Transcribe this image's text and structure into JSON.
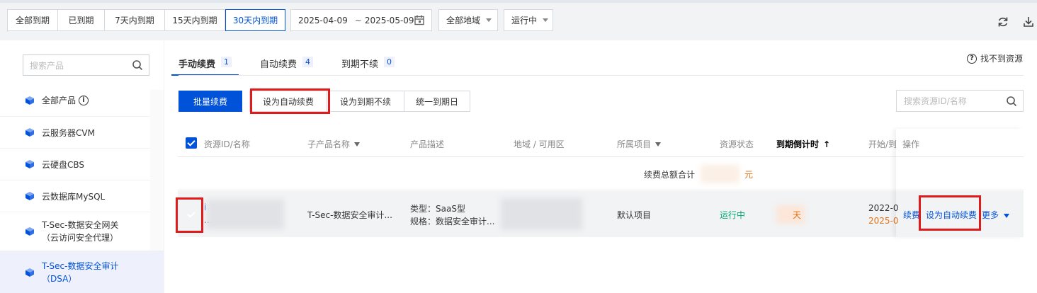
{
  "filter": {
    "expiry_options": [
      {
        "label": "全部到期",
        "active": false
      },
      {
        "label": "已到期",
        "active": false
      },
      {
        "label": "7天内到期",
        "active": false
      },
      {
        "label": "15天内到期",
        "active": false
      },
      {
        "label": "30天内到期",
        "active": true
      }
    ],
    "date_start": "2025-04-09",
    "date_sep": "~",
    "date_end": "2025-05-09",
    "region": "全部地域",
    "status": "运行中",
    "icons": [
      "refresh-icon",
      "download-icon"
    ]
  },
  "sidebar": {
    "search_placeholder": "搜索产品",
    "items": [
      {
        "label": "全部产品",
        "has_info": true,
        "active": false
      },
      {
        "label": "云服务器CVM",
        "active": false
      },
      {
        "label": "云硬盘CBS",
        "active": false
      },
      {
        "label": "云数据库MySQL",
        "active": false
      },
      {
        "label_line1": "T-Sec-数据安全网关",
        "label_line2": "（云访问安全代理）",
        "active": false
      },
      {
        "label_line1": "T-Sec-数据安全审计",
        "label_line2": "（DSA）",
        "active": true
      }
    ]
  },
  "tabs": [
    {
      "label": "手动续费",
      "count": "1",
      "active": true
    },
    {
      "label": "自动续费",
      "count": "4",
      "active": false
    },
    {
      "label": "到期不续",
      "count": "0",
      "active": false
    }
  ],
  "cant_find": "找不到资源",
  "actions": {
    "batch_renew": "批量续费",
    "set_auto_renew": "设为自动续费",
    "set_no_renew": "设为到期不续",
    "unify_expiry": "统一到期日"
  },
  "table_search_placeholder": "搜索资源ID/名称",
  "columns": {
    "resource": "资源ID/名称",
    "sub_product": "子产品名称",
    "description": "产品描述",
    "region": "地域 / 可用区",
    "project": "所属项目",
    "status": "资源状态",
    "countdown": "到期倒计时",
    "start_end": "开始/到",
    "operation": "操作"
  },
  "summary": {
    "label": "续费总额合计",
    "suffix": "元"
  },
  "row": {
    "resource_line1": "i",
    "resource_line2": "...",
    "sub_product": "T-Sec-数据安全审计...",
    "desc_line1": "类型：SaaS型",
    "desc_line2": "规格：数据安全审计...",
    "project": "默认项目",
    "status": "运行中",
    "countdown_suffix": "天",
    "start": "2022-0",
    "end": "2025-0",
    "op_renew": "续费",
    "op_set_auto": "设为自动续费",
    "op_more": "更多"
  },
  "colors": {
    "accent": "#0052d9",
    "running": "#00a870",
    "warning": "#e37318",
    "highlight_box": "#e01b1b"
  }
}
